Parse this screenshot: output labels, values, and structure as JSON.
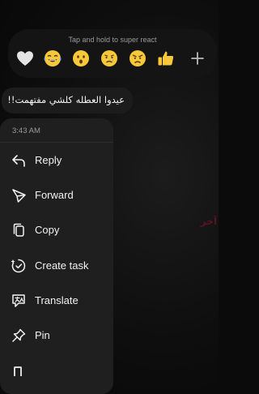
{
  "background": {
    "faded_text": "آخر"
  },
  "reactions": {
    "hint": "Tap and hold to super react",
    "items": [
      {
        "name": "white-heart-icon"
      },
      {
        "name": "tears-of-joy-icon"
      },
      {
        "name": "astonished-face-icon"
      },
      {
        "name": "crying-face-icon"
      },
      {
        "name": "angry-face-icon"
      },
      {
        "name": "thumbs-up-icon"
      },
      {
        "name": "plus-icon"
      }
    ]
  },
  "message": {
    "text": "عيدوا العطله كلشي مفتهمت!!"
  },
  "menu": {
    "timestamp": "3:43 AM",
    "items": [
      {
        "label": "Reply",
        "icon": "reply-icon"
      },
      {
        "label": "Forward",
        "icon": "forward-icon"
      },
      {
        "label": "Copy",
        "icon": "copy-icon"
      },
      {
        "label": "Create task",
        "icon": "create-task-icon"
      },
      {
        "label": "Translate",
        "icon": "translate-icon"
      },
      {
        "label": "Pin",
        "icon": "pin-icon"
      }
    ]
  },
  "colors": {
    "background": "#0b0b0b",
    "surface": "#1f1f1f",
    "text": "#f2f2f2",
    "muted": "#9a9a9a",
    "emoji_yellow": "#f7c83a"
  }
}
